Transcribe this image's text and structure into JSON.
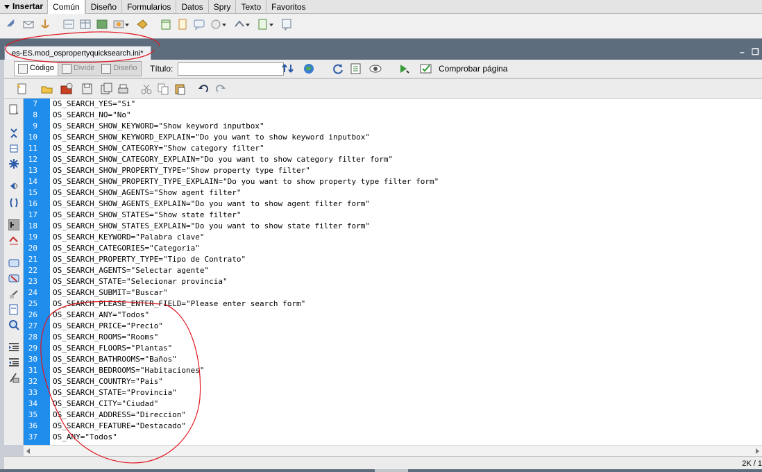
{
  "insert_bar": {
    "title": "Insertar",
    "tabs": [
      "Común",
      "Diseño",
      "Formularios",
      "Datos",
      "Spry",
      "Texto",
      "Favoritos"
    ],
    "active_tab": "Común"
  },
  "document": {
    "tab_title": "es-ES.mod_ospropertyquicksearch.ini*",
    "minimize_glyph": "–",
    "restore_glyph": "❐"
  },
  "doc_toolbar": {
    "view_code": "Código",
    "view_split": "Dividir",
    "view_design": "Diseño",
    "title_label": "Título:",
    "title_value": "",
    "check_page": "Comprobar página"
  },
  "editor": {
    "lines": [
      {
        "num": "7",
        "text": "OS_SEARCH_YES=\"Si\""
      },
      {
        "num": "8",
        "text": "OS_SEARCH_NO=\"No\""
      },
      {
        "num": "9",
        "text": "OS_SEARCH_SHOW_KEYWORD=\"Show keyword inputbox\""
      },
      {
        "num": "10",
        "text": "OS_SEARCH_SHOW_KEYWORD_EXPLAIN=\"Do you want to show keyword inputbox\""
      },
      {
        "num": "11",
        "text": "OS_SEARCH_SHOW_CATEGORY=\"Show category filter\""
      },
      {
        "num": "12",
        "text": "OS_SEARCH_SHOW_CATEGORY_EXPLAIN=\"Do you want to show category filter form\""
      },
      {
        "num": "13",
        "text": "OS_SEARCH_SHOW_PROPERTY_TYPE=\"Show property type filter\""
      },
      {
        "num": "14",
        "text": "OS_SEARCH_SHOW_PROPERTY_TYPE_EXPLAIN=\"Do you want to show property type filter form\""
      },
      {
        "num": "15",
        "text": "OS_SEARCH_SHOW_AGENTS=\"Show agent filter\""
      },
      {
        "num": "16",
        "text": "OS_SEARCH_SHOW_AGENTS_EXPLAIN=\"Do you want to show agent filter form\""
      },
      {
        "num": "17",
        "text": "OS_SEARCH_SHOW_STATES=\"Show state filter\""
      },
      {
        "num": "18",
        "text": "OS_SEARCH_SHOW_STATES_EXPLAIN=\"Do you want to show state filter form\""
      },
      {
        "num": "19",
        "text": "OS_SEARCH_KEYWORD=\"Palabra clave\""
      },
      {
        "num": "20",
        "text": "OS_SEARCH_CATEGORIES=\"Categoria\""
      },
      {
        "num": "21",
        "text": "OS_SEARCH_PROPERTY_TYPE=\"Tipo de Contrato\""
      },
      {
        "num": "22",
        "text": "OS_SEARCH_AGENTS=\"Selectar agente\""
      },
      {
        "num": "23",
        "text": "OS_SEARCH_STATE=\"Selecionar provincia\""
      },
      {
        "num": "24",
        "text": "OS_SEARCH_SUBMIT=\"Buscar\""
      },
      {
        "num": "25",
        "text": "OS_SEARCH_PLEASE_ENTER_FIELD=\"Please enter search form\""
      },
      {
        "num": "26",
        "text": "OS_SEARCH_ANY=\"Todos\""
      },
      {
        "num": "27",
        "text": "OS_SEARCH_PRICE=\"Precio\""
      },
      {
        "num": "28",
        "text": "OS_SEARCH_ROOMS=\"Rooms\""
      },
      {
        "num": "29",
        "text": "OS_SEARCH_FLOORS=\"Plantas\""
      },
      {
        "num": "30",
        "text": "OS_SEARCH_BATHROOMS=\"Baños\""
      },
      {
        "num": "31",
        "text": "OS_SEARCH_BEDROOMS=\"Habitaciones\""
      },
      {
        "num": "32",
        "text": "OS_SEARCH_COUNTRY=\"Pais\""
      },
      {
        "num": "33",
        "text": "OS_SEARCH_STATE=\"Provincia\""
      },
      {
        "num": "34",
        "text": "OS_SEARCH_CITY=\"Ciudad\""
      },
      {
        "num": "35",
        "text": "OS_SEARCH_ADDRESS=\"Direccion\""
      },
      {
        "num": "36",
        "text": "OS_SEARCH_FEATURE=\"Destacado\""
      },
      {
        "num": "37",
        "text": "OS_ANY=\"Todos\""
      }
    ]
  },
  "status": {
    "size": "2K / 1"
  },
  "colors": {
    "gutter": "#1f8dec",
    "panel_dark": "#5e6d7d",
    "annotation": "#e0141e"
  },
  "icons": {
    "insert_bar": [
      "hyperlink-icon",
      "email-link-icon",
      "named-anchor-icon",
      "horizontal-rule-icon",
      "table-icon",
      "div-icon",
      "images-icon",
      "media-icon",
      "date-icon",
      "server-include-icon",
      "comment-icon",
      "head-icon",
      "script-icon",
      "templates-icon",
      "tag-chooser-icon"
    ],
    "doc_toolbar": [
      "file-management-icon",
      "preview-in-browser-icon",
      "refresh-icon",
      "view-options-icon",
      "visual-aids-icon",
      "validate-markup-icon",
      "check-page-icon"
    ],
    "std_toolbar": [
      "new-document-icon",
      "open-icon",
      "browse-in-bridge-icon",
      "save-icon",
      "save-all-icon",
      "print-code-icon",
      "cut-icon",
      "copy-icon",
      "paste-icon",
      "undo-icon",
      "redo-icon"
    ],
    "coding_toolbar": [
      "open-documents-icon",
      "collapse-full-tag-icon",
      "collapse-selection-icon",
      "expand-all-icon",
      "select-parent-tag-icon",
      "balance-braces-icon",
      "line-numbers-icon",
      "highlight-invalid-code-icon",
      "apply-comment-icon",
      "remove-comment-icon",
      "wrap-tag-icon",
      "recent-snippets-icon",
      "move-css-icon",
      "indent-code-icon",
      "outdent-code-icon",
      "format-source-icon"
    ]
  }
}
